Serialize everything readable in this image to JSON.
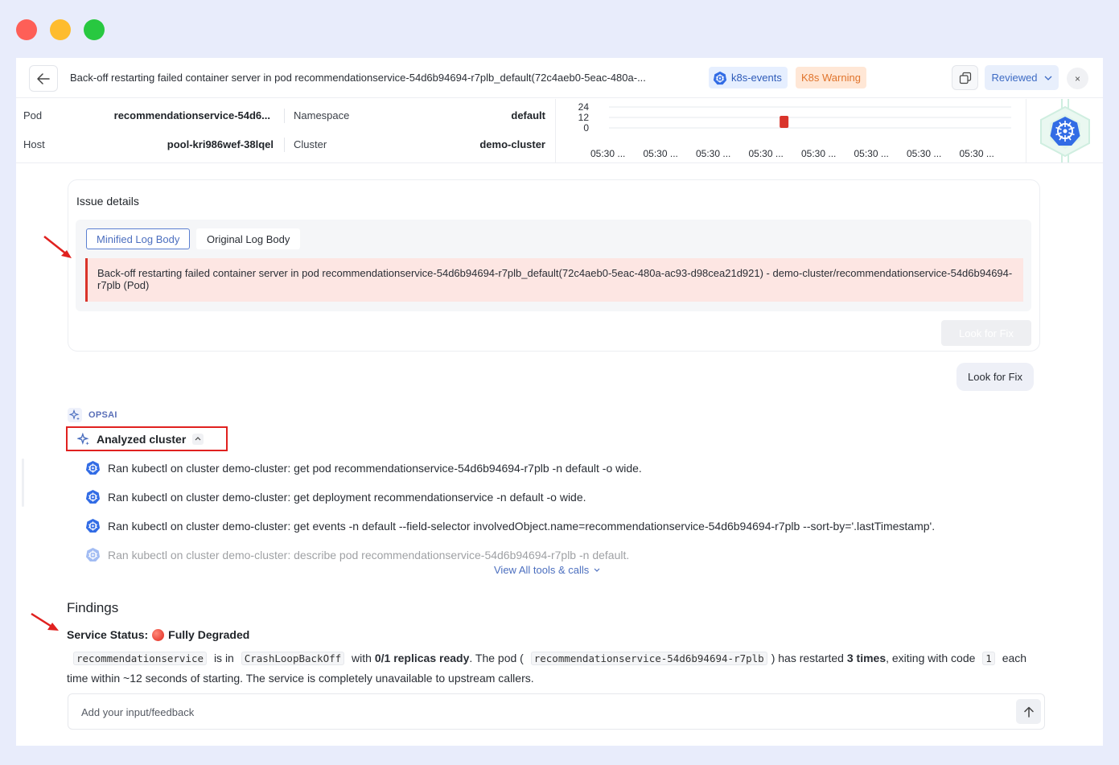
{
  "window": {
    "traffic_lights": [
      "close",
      "minimize",
      "zoom"
    ]
  },
  "header": {
    "title": "Back-off restarting failed container server in pod recommendationservice-54d6b94694-r7plb_default(72c4aeb0-5eac-480a-...",
    "tags": {
      "source": "k8s-events",
      "severity": "K8s Warning"
    },
    "status_select": "Reviewed",
    "close_label": "×"
  },
  "info": {
    "pod_label": "Pod",
    "pod_value": "recommendationservice-54d6...",
    "namespace_label": "Namespace",
    "namespace_value": "default",
    "host_label": "Host",
    "host_value": "pool-kri986wef-38lqel",
    "cluster_label": "Cluster",
    "cluster_value": "demo-cluster"
  },
  "chart_data": {
    "type": "bar",
    "title": "",
    "y_ticks": [
      "24",
      "12",
      "0"
    ],
    "ylim": [
      0,
      24
    ],
    "categories": [
      "05:30 ...",
      "05:30 ...",
      "05:30 ...",
      "05:30 ...",
      "05:30 ...",
      "05:30 ...",
      "05:30 ...",
      "05:30 ..."
    ],
    "bars": [
      {
        "position_between_ticks": 3.3,
        "value": 12,
        "color": "#d9342b"
      }
    ]
  },
  "issue": {
    "title": "Issue details",
    "tab_minified": "Minified Log Body",
    "tab_original": "Original Log Body",
    "log_body": "Back-off restarting failed container server in pod recommendationservice-54d6b94694-r7plb_default(72c4aeb0-5eac-480a-ac93-d98cea21d921) - demo-cluster/recommendationservice-54d6b94694-r7plb (Pod)",
    "fix_button": "Look for Fix"
  },
  "chat": {
    "user_message": "Look for Fix",
    "agent_name": "OPSAI",
    "analyzed_label": "Analyzed cluster",
    "tool_calls": [
      "Ran kubectl on cluster demo-cluster: get pod recommendationservice-54d6b94694-r7plb -n default -o wide.",
      "Ran kubectl on cluster demo-cluster: get deployment recommendationservice -n default -o wide.",
      "Ran kubectl on cluster demo-cluster: get events -n default --field-selector involvedObject.name=recommendationservice-54d6b94694-r7plb --sort-by='.lastTimestamp'.",
      "Ran kubectl on cluster demo-cluster: describe pod recommendationservice-54d6b94694-r7plb -n default."
    ],
    "view_all": "View All tools & calls"
  },
  "findings": {
    "title": "Findings",
    "status_label": "Service Status:",
    "status_value": "Fully Degraded",
    "code_service": "recommendationservice",
    "t_is_in": "is in",
    "code_state": "CrashLoopBackOff",
    "t_with": "with",
    "b_replicas": "0/1 replicas ready",
    "t_the_pod": ". The pod (",
    "code_pod": "recommendationservice-54d6b94694-r7plb",
    "t_restarted": ") has restarted",
    "b_times": "3 times",
    "t_exiting": ", exiting with code",
    "code_exit": "1",
    "t_tail": "each time within ~12 seconds of starting. The service is completely unavailable to upstream callers."
  },
  "feedback": {
    "placeholder": "Add your input/feedback"
  },
  "colors": {
    "accent": "#4c6fbf",
    "danger": "#d9342b",
    "warning": "#e0742c",
    "annotation": "#e0211f"
  }
}
